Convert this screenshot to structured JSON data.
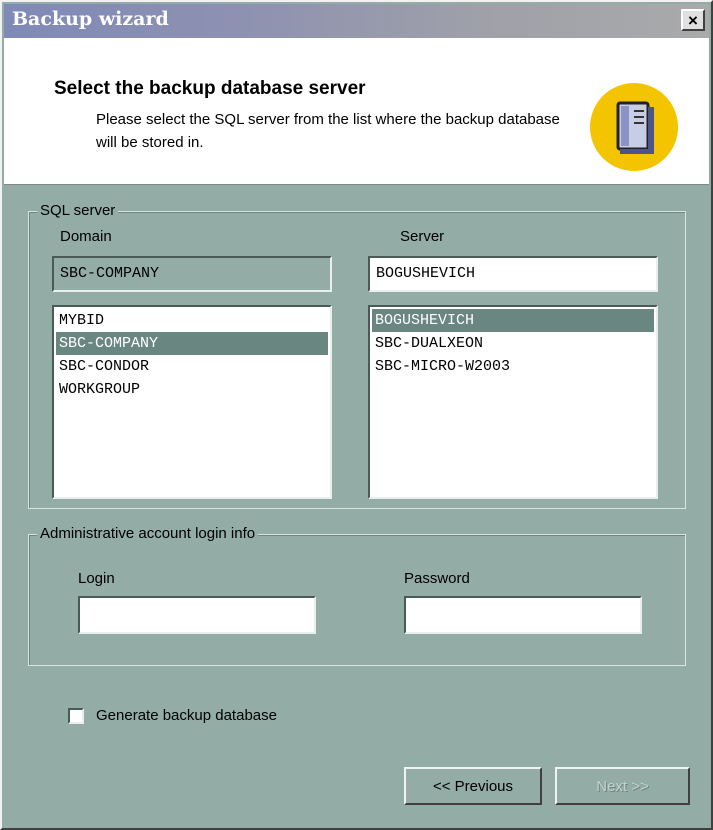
{
  "window": {
    "title": "Backup wizard",
    "close_label": "×"
  },
  "header": {
    "title": "Select the backup database server",
    "description": "Please select the SQL server from the list where the backup database will be stored in."
  },
  "sql_server": {
    "legend": "SQL server",
    "domain_label": "Domain",
    "server_label": "Server",
    "domain_value": "SBC-COMPANY",
    "server_value": "BOGUSHEVICH",
    "domains": [
      "MYBID",
      "SBC-COMPANY",
      "SBC-CONDOR",
      "WORKGROUP"
    ],
    "selected_domain": "SBC-COMPANY",
    "servers": [
      "BOGUSHEVICH",
      "SBC-DUALXEON",
      "SBC-MICRO-W2003"
    ],
    "selected_server": "BOGUSHEVICH"
  },
  "login": {
    "legend": "Administrative account login info",
    "login_label": "Login",
    "password_label": "Password",
    "login_value": "",
    "password_value": ""
  },
  "options": {
    "generate_label": "Generate backup database",
    "generate_checked": false
  },
  "buttons": {
    "previous": "<< Previous",
    "next": "Next >>"
  },
  "colors": {
    "dialog_bg": "#93aca5",
    "selection": "#6a8680",
    "icon_circle": "#f5c400"
  }
}
